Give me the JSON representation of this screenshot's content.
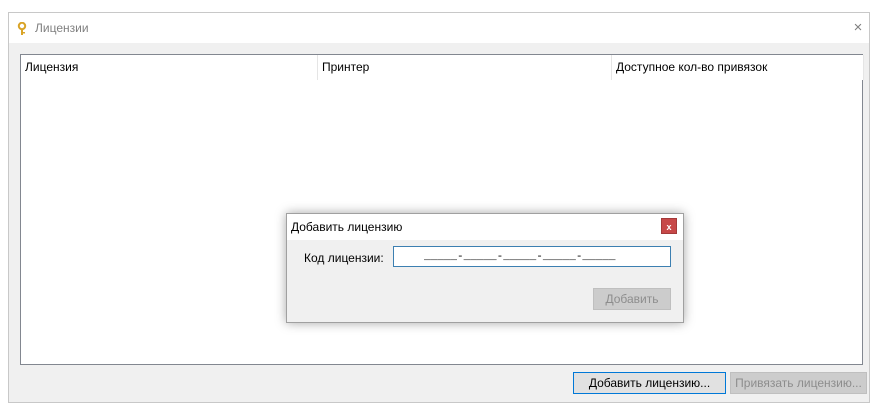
{
  "window": {
    "title": "Лицензии",
    "close_glyph": "×"
  },
  "table": {
    "columns": [
      "Лицензия",
      "Принтер",
      "Доступное кол-во привязок"
    ],
    "rows": []
  },
  "buttons": {
    "add_license": "Добавить лицензию...",
    "bind_license": "Привязать лицензию..."
  },
  "dialog": {
    "title": "Добавить лицензию",
    "close_glyph": "x",
    "label": "Код лицензии:",
    "input_value": "_____-_____-_____-_____-_____",
    "submit": "Добавить"
  },
  "colors": {
    "accent_border": "#0078d7",
    "dialog_close_bg": "#c74848",
    "key_icon": "#d9a428"
  },
  "icons": {
    "window_icon": "key-icon",
    "close": "close-icon"
  }
}
